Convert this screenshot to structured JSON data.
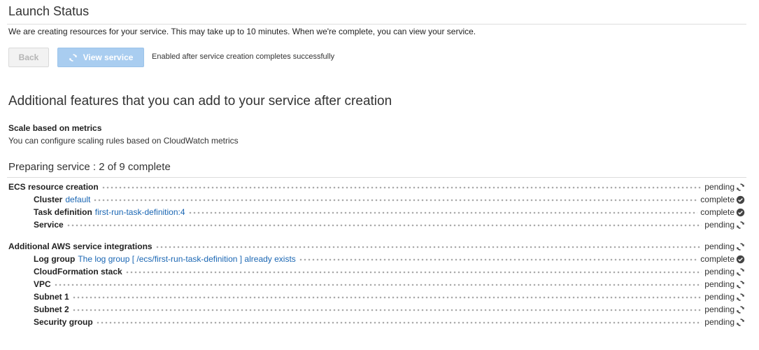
{
  "page": {
    "title": "Launch Status",
    "description": "We are creating resources for your service. This may take up to 10 minutes. When we're complete, you can view your service."
  },
  "buttons": {
    "back_label": "Back",
    "view_service_label": "View service",
    "view_service_icon": "refresh-icon",
    "note": "Enabled after service creation completes successfully"
  },
  "additional_features": {
    "heading": "Additional features that you can add to your service after creation",
    "items": [
      {
        "title": "Scale based on metrics",
        "description": "You can configure scaling rules based on CloudWatch metrics"
      }
    ]
  },
  "progress": {
    "heading": "Preparing service : 2 of 9 complete",
    "groups": [
      {
        "label": "ECS resource creation",
        "status": "pending",
        "items": [
          {
            "label": "Cluster",
            "link": "default",
            "status": "complete"
          },
          {
            "label": "Task definition",
            "link": "first-run-task-definition:4",
            "status": "complete"
          },
          {
            "label": "Service",
            "link": "",
            "status": "pending"
          }
        ]
      },
      {
        "label": "Additional AWS service integrations",
        "status": "pending",
        "items": [
          {
            "label": "Log group",
            "link": "The log group [ /ecs/first-run-task-definition ] already exists",
            "status": "complete"
          },
          {
            "label": "CloudFormation stack",
            "link": "",
            "status": "pending"
          },
          {
            "label": "VPC",
            "link": "",
            "status": "pending"
          },
          {
            "label": "Subnet 1",
            "link": "",
            "status": "pending"
          },
          {
            "label": "Subnet 2",
            "link": "",
            "status": "pending"
          },
          {
            "label": "Security group",
            "link": "",
            "status": "pending"
          }
        ]
      }
    ]
  },
  "colors": {
    "link": "#1a66b3",
    "primary_disabled": "#a9cdf0",
    "status_icon": "#444444"
  }
}
